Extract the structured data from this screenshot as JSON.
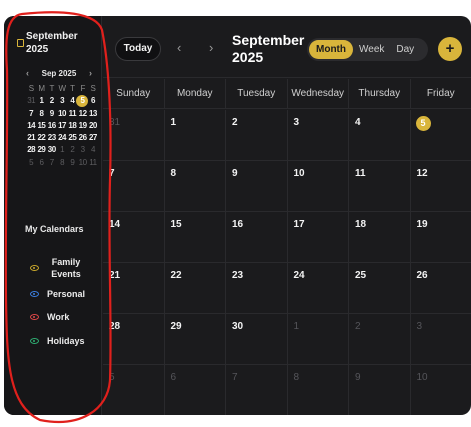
{
  "sidebar": {
    "title": "September 2025",
    "mini_nav": {
      "label": "Sep 2025",
      "prev": "‹",
      "next": "›"
    },
    "dow": [
      "S",
      "M",
      "T",
      "W",
      "T",
      "F",
      "S"
    ],
    "mini_days": [
      {
        "d": "31",
        "dim": true
      },
      {
        "d": "1"
      },
      {
        "d": "2"
      },
      {
        "d": "3"
      },
      {
        "d": "4"
      },
      {
        "d": "5",
        "today": true
      },
      {
        "d": "6"
      },
      {
        "d": "7"
      },
      {
        "d": "8"
      },
      {
        "d": "9"
      },
      {
        "d": "10"
      },
      {
        "d": "11"
      },
      {
        "d": "12"
      },
      {
        "d": "13"
      },
      {
        "d": "14"
      },
      {
        "d": "15"
      },
      {
        "d": "16"
      },
      {
        "d": "17"
      },
      {
        "d": "18"
      },
      {
        "d": "19"
      },
      {
        "d": "20"
      },
      {
        "d": "21"
      },
      {
        "d": "22"
      },
      {
        "d": "23"
      },
      {
        "d": "24"
      },
      {
        "d": "25"
      },
      {
        "d": "26"
      },
      {
        "d": "27"
      },
      {
        "d": "28"
      },
      {
        "d": "29"
      },
      {
        "d": "30"
      },
      {
        "d": "1",
        "dim": true
      },
      {
        "d": "2",
        "dim": true
      },
      {
        "d": "3",
        "dim": true
      },
      {
        "d": "4",
        "dim": true
      },
      {
        "d": "5",
        "dim": true
      },
      {
        "d": "6",
        "dim": true
      },
      {
        "d": "7",
        "dim": true
      },
      {
        "d": "8",
        "dim": true
      },
      {
        "d": "9",
        "dim": true
      },
      {
        "d": "10",
        "dim": true
      },
      {
        "d": "11",
        "dim": true
      }
    ],
    "my_calendars_title": "My Calendars",
    "calendars": [
      {
        "label": "Family Events",
        "color": "#c9a82c",
        "icon": "eye-icon"
      },
      {
        "label": "Personal",
        "color": "#3b7fe0",
        "icon": "eye-icon"
      },
      {
        "label": "Work",
        "color": "#e04848",
        "icon": "eye-icon"
      },
      {
        "label": "Holidays",
        "color": "#2fae72",
        "icon": "eye-icon"
      }
    ]
  },
  "header": {
    "today_label": "Today",
    "prev": "‹",
    "next": "›",
    "month_title": "September 2025",
    "views": [
      "Month",
      "Week",
      "Day"
    ],
    "active_view": "Month",
    "add_label": "+"
  },
  "weekdays": [
    "Sunday",
    "Monday",
    "Tuesday",
    "Wednesday",
    "Thursday",
    "Friday"
  ],
  "weeks": [
    [
      {
        "d": "31",
        "other": true
      },
      {
        "d": "1"
      },
      {
        "d": "2"
      },
      {
        "d": "3"
      },
      {
        "d": "4"
      },
      {
        "d": "5",
        "today": true
      }
    ],
    [
      {
        "d": "7"
      },
      {
        "d": "8"
      },
      {
        "d": "9"
      },
      {
        "d": "10"
      },
      {
        "d": "11"
      },
      {
        "d": "12"
      }
    ],
    [
      {
        "d": "14"
      },
      {
        "d": "15"
      },
      {
        "d": "16"
      },
      {
        "d": "17"
      },
      {
        "d": "18"
      },
      {
        "d": "19"
      }
    ],
    [
      {
        "d": "21"
      },
      {
        "d": "22"
      },
      {
        "d": "23"
      },
      {
        "d": "24"
      },
      {
        "d": "25"
      },
      {
        "d": "26"
      }
    ],
    [
      {
        "d": "28"
      },
      {
        "d": "29"
      },
      {
        "d": "30"
      },
      {
        "d": "1",
        "other": true
      },
      {
        "d": "2",
        "other": true
      },
      {
        "d": "3",
        "other": true
      }
    ],
    [
      {
        "d": "5",
        "other": true
      },
      {
        "d": "6",
        "other": true
      },
      {
        "d": "7",
        "other": true
      },
      {
        "d": "8",
        "other": true
      },
      {
        "d": "9",
        "other": true
      },
      {
        "d": "10",
        "other": true
      }
    ]
  ],
  "colors": {
    "accent": "#d9b53b",
    "annotation": "#e0201c",
    "background": "#1b1b1d"
  }
}
